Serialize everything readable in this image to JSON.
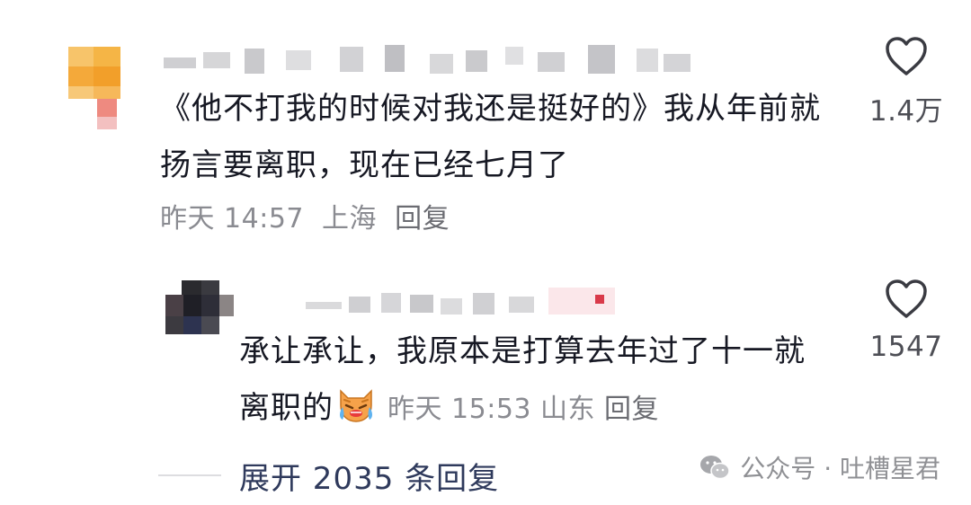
{
  "comments": [
    {
      "text": "《他不打我的时候对我还是挺好的》我从年前就扬言要离职，现在已经七月了",
      "time": "昨天 14:57",
      "location": "上海",
      "reply_label": "回复",
      "likes": "1.4万"
    },
    {
      "text": "承让承让，我原本是打算去年过了十一就离职的",
      "time": "昨天 15:53",
      "location": "山东",
      "reply_label": "回复",
      "likes": "1547"
    }
  ],
  "expand_replies": "展开 2035 条回复",
  "watermark": "公众号 · 吐槽星君",
  "icons": {
    "like": "heart-outline-icon",
    "emoji": "crying-cat-emoji-icon",
    "watermark": "wechat-icon"
  },
  "colors": {
    "text": "#161823",
    "meta": "#8a8b91",
    "link": "#2f3a5c",
    "avatar_1": "#f5a623"
  }
}
